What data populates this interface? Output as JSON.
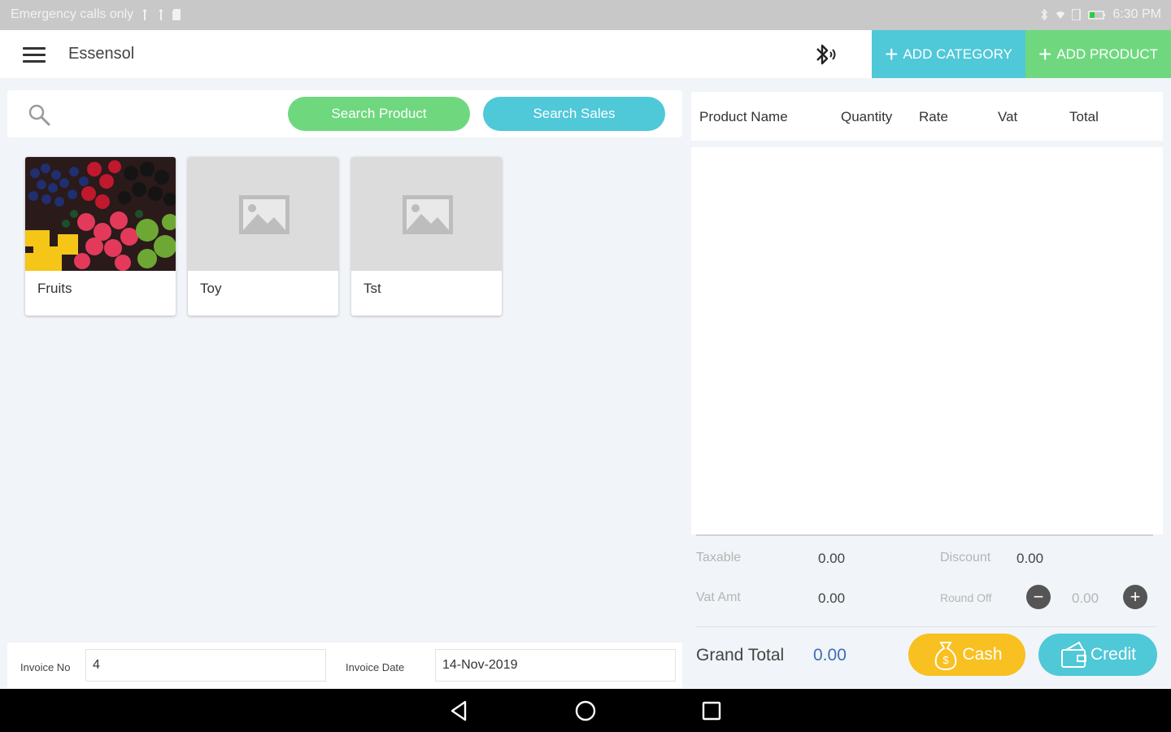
{
  "status_bar": {
    "left_text": "Emergency calls only",
    "time": "6:30 PM"
  },
  "app_bar": {
    "title": "Essensol",
    "add_category_label": "ADD CATEGORY",
    "add_product_label": "ADD PRODUCT"
  },
  "search": {
    "placeholder": "",
    "search_product_label": "Search Product",
    "search_sales_label": "Search Sales"
  },
  "categories": [
    {
      "label": "Fruits",
      "image": "fruits-photo"
    },
    {
      "label": "Toy",
      "image": "image-placeholder-icon"
    },
    {
      "label": "Tst",
      "image": "image-placeholder-icon"
    }
  ],
  "invoice": {
    "no_label": "Invoice No",
    "no_value": "4",
    "date_label": "Invoice Date",
    "date_value": "14-Nov-2019"
  },
  "table": {
    "headers": [
      "Product Name",
      "Quantity",
      "Rate",
      "Vat",
      "Total"
    ],
    "rows": []
  },
  "summary": {
    "taxable_label": "Taxable",
    "taxable_value": "0.00",
    "discount_label": "Discount",
    "discount_value": "0.00",
    "vat_label": "Vat Amt",
    "vat_value": "0.00",
    "roundoff_label": "Round Off",
    "roundoff_value": "0.00",
    "grand_total_label": "Grand Total",
    "grand_total_value": "0.00"
  },
  "payment": {
    "cash_label": "Cash",
    "credit_label": "Credit"
  },
  "colors": {
    "teal": "#4fc8d8",
    "green": "#6fd87f",
    "cash_yellow": "#f8c020",
    "grand_total_blue": "#3b6fb6"
  }
}
